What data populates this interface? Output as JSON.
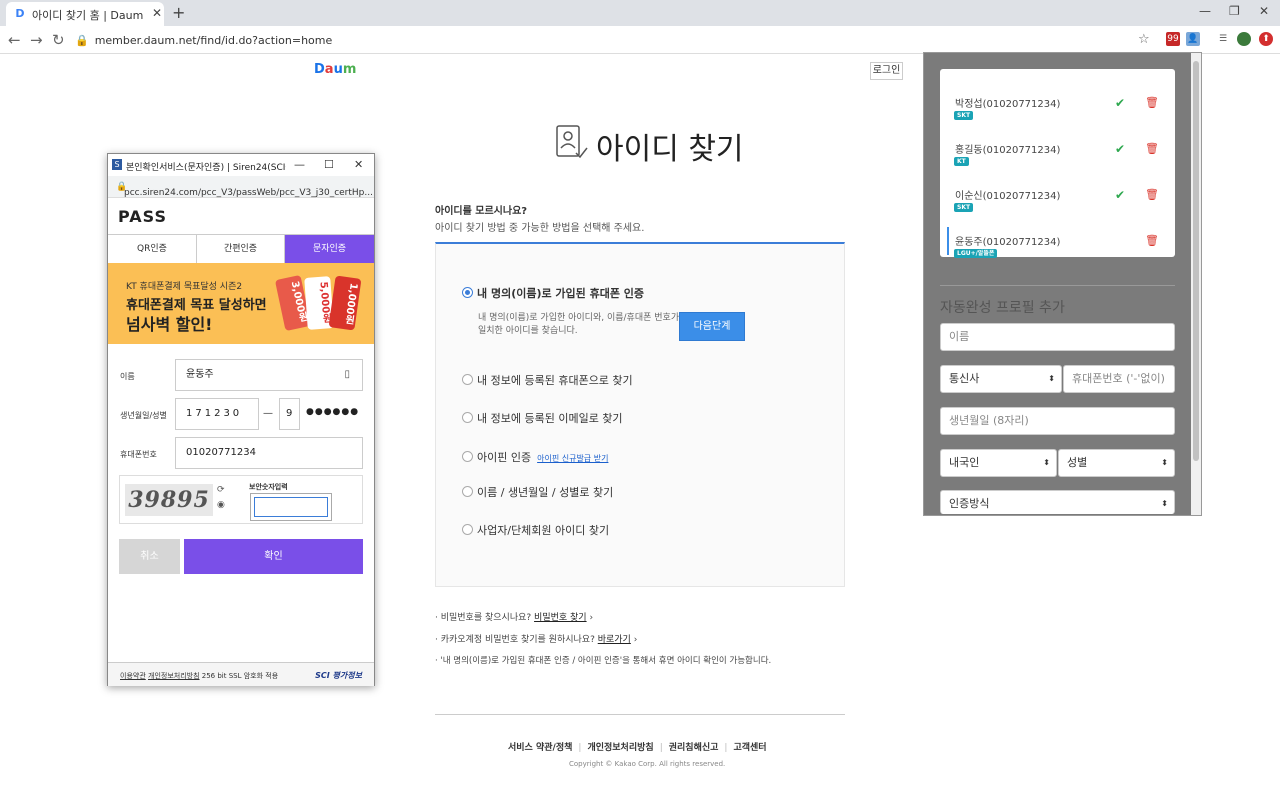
{
  "browser": {
    "tab_title": "아이디 찾기 홈 | Daum 아이디 찾기",
    "favicon": "D",
    "url": "member.daum.net/find/id.do?action=home",
    "ext_badge": "99"
  },
  "daum": {
    "logo": {
      "d": "D",
      "a": "a",
      "u": "u",
      "m": "m"
    },
    "login_button": "로그인",
    "page_title": "아이디 찾기",
    "question": "아이디를 모르시나요?",
    "question_desc": "아이디 찾기 방법 중 가능한 방법을 선택해 주세요.",
    "options": [
      {
        "label": "내 명의(이름)로 가입된 휴대폰 인증",
        "selected": true
      },
      {
        "label": "내 정보에 등록된 휴대폰으로 찾기",
        "selected": false
      },
      {
        "label": "내 정보에 등록된 이메일로 찾기",
        "selected": false
      },
      {
        "label": "아이핀 인증",
        "selected": false
      },
      {
        "label": "이름 / 생년월일 / 성별로 찾기",
        "selected": false
      },
      {
        "label": "사업자/단체회원 아이디 찾기",
        "selected": false
      }
    ],
    "option_desc": "내 명의(이름)로 가입한 아이디와, 이름/휴대폰 번호가 일치한 아이디를 찾습니다.",
    "next_button": "다음단계",
    "ipin_link": "아이핀 신규발급 받기",
    "foot1_text": "· 비밀번호를 찾으시나요?",
    "foot1_link": "비밀번호 찾기",
    "foot2_text": "· 카카오계정 비밀번호 찾기를 원하시나요?",
    "foot2_link": "바로가기",
    "foot3_text": "· '내 명의(이름)로 가입된 휴대폰 인증 / 아이핀 인증'을 통해서 휴면 아이디 확인이 가능합니다.",
    "bottom_links": [
      "서비스 약관/정책",
      "개인정보처리방침",
      "권리침해신고",
      "고객센터"
    ],
    "copyright": "Copyright © Kakao Corp. All rights reserved."
  },
  "popup": {
    "title": "본인확인서비스(문자인증) | Siren24(SCI평가정보)",
    "url": "pcc.siren24.com/pcc_V3/passWeb/pcc_V3_j30_certHp...",
    "brand": "PASS",
    "tabs": [
      "QR인증",
      "간편인증",
      "문자인증"
    ],
    "active_tab": 2,
    "banner_line1": "KT 휴대폰결제 목표달성 시즌2",
    "banner_line2": "휴대폰결제 목표 달성하면",
    "banner_line3": "넘사벽 할인!",
    "banner_cards": [
      "3,000원",
      "5,000원",
      "1,000원"
    ],
    "name_label": "이름",
    "name_value": "윤동주",
    "birth_label": "생년월일/성별",
    "birth_value": "171230",
    "gender_value": "9",
    "birth_mask": "●●●●●●",
    "phone_label": "휴대폰번호",
    "phone_value": "01020771234",
    "captcha_text": "39895",
    "captcha_label": "보안숫자입력",
    "captcha_value": "",
    "cancel_button": "취소",
    "confirm_button": "확인",
    "footer_terms": "이용약관",
    "footer_privacy": "개인정보처리방침",
    "footer_ssl": "256 bit SSL 암호화 적용",
    "footer_brand": "SCI 평가정보"
  },
  "extension": {
    "profiles": [
      {
        "name": "박정섭(01020771234)",
        "carrier": "SKT",
        "checked": true
      },
      {
        "name": "홍길동(01020771234)",
        "carrier": "KT",
        "checked": true
      },
      {
        "name": "이순신(01020771234)",
        "carrier": "SKT",
        "checked": true
      },
      {
        "name": "윤동주(01020771234)",
        "carrier": "LGU+/알뜰폰",
        "checked": false
      }
    ],
    "section_title": "자동완성 프로필 추가",
    "name_placeholder": "이름",
    "carrier_select": "통신사",
    "phone_placeholder": "휴대폰번호 ('-'없이)",
    "birth_placeholder": "생년월일 (8자리)",
    "nationality_select": "내국인",
    "gender_select": "성별",
    "auth_select": "인증방식"
  },
  "colors": {
    "accent": "#3b7dd8",
    "pass_purple": "#7a4fe8",
    "banner": "#fbbf55",
    "ext_bg": "#7b7b7b"
  }
}
